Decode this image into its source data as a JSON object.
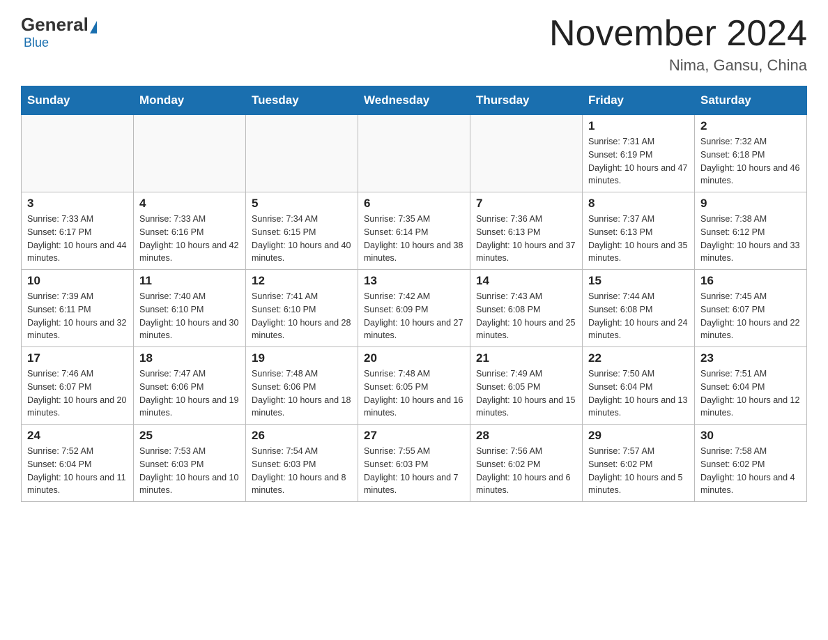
{
  "header": {
    "logo_general": "General",
    "logo_blue": "Blue",
    "month_title": "November 2024",
    "location": "Nima, Gansu, China"
  },
  "days_of_week": [
    "Sunday",
    "Monday",
    "Tuesday",
    "Wednesday",
    "Thursday",
    "Friday",
    "Saturday"
  ],
  "weeks": [
    [
      {
        "day": "",
        "info": ""
      },
      {
        "day": "",
        "info": ""
      },
      {
        "day": "",
        "info": ""
      },
      {
        "day": "",
        "info": ""
      },
      {
        "day": "",
        "info": ""
      },
      {
        "day": "1",
        "info": "Sunrise: 7:31 AM\nSunset: 6:19 PM\nDaylight: 10 hours and 47 minutes."
      },
      {
        "day": "2",
        "info": "Sunrise: 7:32 AM\nSunset: 6:18 PM\nDaylight: 10 hours and 46 minutes."
      }
    ],
    [
      {
        "day": "3",
        "info": "Sunrise: 7:33 AM\nSunset: 6:17 PM\nDaylight: 10 hours and 44 minutes."
      },
      {
        "day": "4",
        "info": "Sunrise: 7:33 AM\nSunset: 6:16 PM\nDaylight: 10 hours and 42 minutes."
      },
      {
        "day": "5",
        "info": "Sunrise: 7:34 AM\nSunset: 6:15 PM\nDaylight: 10 hours and 40 minutes."
      },
      {
        "day": "6",
        "info": "Sunrise: 7:35 AM\nSunset: 6:14 PM\nDaylight: 10 hours and 38 minutes."
      },
      {
        "day": "7",
        "info": "Sunrise: 7:36 AM\nSunset: 6:13 PM\nDaylight: 10 hours and 37 minutes."
      },
      {
        "day": "8",
        "info": "Sunrise: 7:37 AM\nSunset: 6:13 PM\nDaylight: 10 hours and 35 minutes."
      },
      {
        "day": "9",
        "info": "Sunrise: 7:38 AM\nSunset: 6:12 PM\nDaylight: 10 hours and 33 minutes."
      }
    ],
    [
      {
        "day": "10",
        "info": "Sunrise: 7:39 AM\nSunset: 6:11 PM\nDaylight: 10 hours and 32 minutes."
      },
      {
        "day": "11",
        "info": "Sunrise: 7:40 AM\nSunset: 6:10 PM\nDaylight: 10 hours and 30 minutes."
      },
      {
        "day": "12",
        "info": "Sunrise: 7:41 AM\nSunset: 6:10 PM\nDaylight: 10 hours and 28 minutes."
      },
      {
        "day": "13",
        "info": "Sunrise: 7:42 AM\nSunset: 6:09 PM\nDaylight: 10 hours and 27 minutes."
      },
      {
        "day": "14",
        "info": "Sunrise: 7:43 AM\nSunset: 6:08 PM\nDaylight: 10 hours and 25 minutes."
      },
      {
        "day": "15",
        "info": "Sunrise: 7:44 AM\nSunset: 6:08 PM\nDaylight: 10 hours and 24 minutes."
      },
      {
        "day": "16",
        "info": "Sunrise: 7:45 AM\nSunset: 6:07 PM\nDaylight: 10 hours and 22 minutes."
      }
    ],
    [
      {
        "day": "17",
        "info": "Sunrise: 7:46 AM\nSunset: 6:07 PM\nDaylight: 10 hours and 20 minutes."
      },
      {
        "day": "18",
        "info": "Sunrise: 7:47 AM\nSunset: 6:06 PM\nDaylight: 10 hours and 19 minutes."
      },
      {
        "day": "19",
        "info": "Sunrise: 7:48 AM\nSunset: 6:06 PM\nDaylight: 10 hours and 18 minutes."
      },
      {
        "day": "20",
        "info": "Sunrise: 7:48 AM\nSunset: 6:05 PM\nDaylight: 10 hours and 16 minutes."
      },
      {
        "day": "21",
        "info": "Sunrise: 7:49 AM\nSunset: 6:05 PM\nDaylight: 10 hours and 15 minutes."
      },
      {
        "day": "22",
        "info": "Sunrise: 7:50 AM\nSunset: 6:04 PM\nDaylight: 10 hours and 13 minutes."
      },
      {
        "day": "23",
        "info": "Sunrise: 7:51 AM\nSunset: 6:04 PM\nDaylight: 10 hours and 12 minutes."
      }
    ],
    [
      {
        "day": "24",
        "info": "Sunrise: 7:52 AM\nSunset: 6:04 PM\nDaylight: 10 hours and 11 minutes."
      },
      {
        "day": "25",
        "info": "Sunrise: 7:53 AM\nSunset: 6:03 PM\nDaylight: 10 hours and 10 minutes."
      },
      {
        "day": "26",
        "info": "Sunrise: 7:54 AM\nSunset: 6:03 PM\nDaylight: 10 hours and 8 minutes."
      },
      {
        "day": "27",
        "info": "Sunrise: 7:55 AM\nSunset: 6:03 PM\nDaylight: 10 hours and 7 minutes."
      },
      {
        "day": "28",
        "info": "Sunrise: 7:56 AM\nSunset: 6:02 PM\nDaylight: 10 hours and 6 minutes."
      },
      {
        "day": "29",
        "info": "Sunrise: 7:57 AM\nSunset: 6:02 PM\nDaylight: 10 hours and 5 minutes."
      },
      {
        "day": "30",
        "info": "Sunrise: 7:58 AM\nSunset: 6:02 PM\nDaylight: 10 hours and 4 minutes."
      }
    ]
  ]
}
